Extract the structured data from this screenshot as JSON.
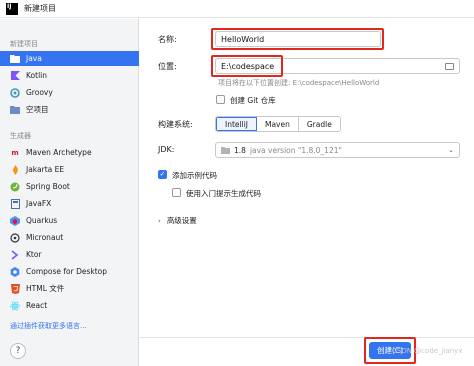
{
  "window": {
    "title": "新建项目",
    "logo_text": "IJ"
  },
  "sidebar": {
    "section_new": "新建项目",
    "items": [
      {
        "label": "Java",
        "icon": "folder-icon",
        "selected": true
      },
      {
        "label": "Kotlin",
        "icon": "kotlin-icon"
      },
      {
        "label": "Groovy",
        "icon": "groovy-icon"
      },
      {
        "label": "空项目",
        "icon": "empty-project-icon"
      }
    ],
    "section_generators": "生成器",
    "generators": [
      {
        "label": "Maven Archetype",
        "icon": "maven-icon"
      },
      {
        "label": "Jakarta EE",
        "icon": "jakarta-icon"
      },
      {
        "label": "Spring Boot",
        "icon": "spring-icon"
      },
      {
        "label": "JavaFX",
        "icon": "javafx-icon"
      },
      {
        "label": "Quarkus",
        "icon": "quarkus-icon"
      },
      {
        "label": "Micronaut",
        "icon": "micronaut-icon"
      },
      {
        "label": "Ktor",
        "icon": "ktor-icon"
      },
      {
        "label": "Compose for Desktop",
        "icon": "compose-icon"
      },
      {
        "label": "HTML 文件",
        "icon": "html-icon"
      },
      {
        "label": "React",
        "icon": "react-icon"
      }
    ],
    "more_link": "通过插件获取更多语言...",
    "help": "?"
  },
  "form": {
    "name_label": "名称:",
    "name_value": "HelloWorld",
    "location_label": "位置:",
    "location_value": "E:\\codespace",
    "location_hint": "项目将在以下位置创建: E:\\codespace\\HelloWorld",
    "git_label": "创建 Git 仓库",
    "build_label": "构建系统:",
    "build_options": [
      "IntelliJ",
      "Maven",
      "Gradle"
    ],
    "build_selected": "IntelliJ",
    "jdk_label": "JDK:",
    "jdk_value": "1.8",
    "jdk_meta": "java version \"1.8.0_121\"",
    "sample_label": "添加示例代码",
    "onboarding_label": "使用入门提示生成代码",
    "advanced_label": "高级设置"
  },
  "footer": {
    "create_label": "创建(C)",
    "watermark": "CSDN @code_jianyx"
  },
  "colors": {
    "accent": "#3574f0",
    "highlight": "#e0281e"
  }
}
